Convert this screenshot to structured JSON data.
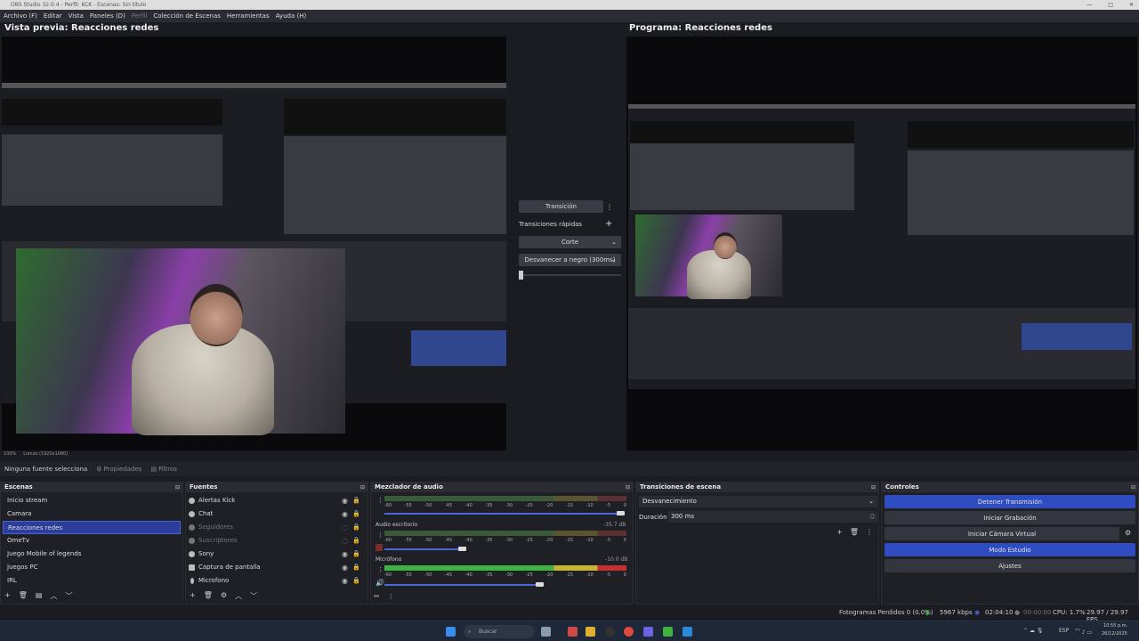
{
  "window": {
    "title": "OBS Studio 32.0.4 - Perfil: KCK - Escenas: Sin título",
    "controls": [
      "—",
      "□",
      "✕"
    ]
  },
  "menu": [
    "Archivo (F)",
    "Editar",
    "Vista",
    "Paneles (D)",
    "Perfil",
    "Colección de Escenas",
    "Herramientas",
    "Ayuda (H)"
  ],
  "preview": {
    "label": "Vista previa: Reacciones redes",
    "zoom": "100%",
    "canvas": "Lienzo (1920x1080)"
  },
  "program": {
    "label": "Programa: Reacciones redes"
  },
  "transition_panel": {
    "transition": "Transición",
    "quick": "Transiciones rápidas",
    "cut": "Corte",
    "fade": "Desvanecer a negro (300ms)"
  },
  "source_bar": {
    "none_selected": "Ninguna fuente selecciona",
    "properties": "Propiedades",
    "filters": "Filtros"
  },
  "scenes": {
    "title": "Escenas",
    "items": [
      "Inicio stream",
      "Camara",
      "Reacciones redes",
      "OmeTv",
      "Juego Mobile of legends",
      "Juegos PC",
      "IRL"
    ],
    "selected": 2
  },
  "sources": {
    "title": "Fuentes",
    "items": [
      "Alertas Kick",
      "Chat",
      "Seguidores",
      "Suscriptores",
      "Sony",
      "Captura de pantalla",
      "Microfono"
    ]
  },
  "mixer": {
    "title": "Mezclador de audio",
    "ticks": [
      "-60",
      "-55",
      "-50",
      "-45",
      "-40",
      "-35",
      "-30",
      "-25",
      "-20",
      "-15",
      "-10",
      "-5",
      "0"
    ],
    "channels": [
      {
        "name": "",
        "db": ""
      },
      {
        "name": "Audio escritorio",
        "db": "-35.7 dB"
      },
      {
        "name": "Micrófono",
        "db": "-10.0 dB"
      }
    ]
  },
  "scene_transitions": {
    "title": "Transiciones de escena",
    "type": "Desvanecimiento",
    "duration_label": "Duración",
    "duration": "300 ms"
  },
  "controls": {
    "title": "Controles",
    "buttons": [
      "Detener Transmisión",
      "Iniciar Grabación",
      "Iniciar Cámara Virtual",
      "Modo Estudio",
      "Ajustes"
    ]
  },
  "status": {
    "dropped": "Fotogramas Perdidos 0 (0.0%)",
    "kbps": "5967 kbps",
    "stream_time": "02:04:10",
    "rec_time": "00:00:00",
    "cpu": "CPU: 1.7%",
    "fps": "29.97 / 29.97 FPS"
  },
  "taskbar": {
    "search": "Buscar",
    "lang": "ESP",
    "time": "10:55 p.m.",
    "date": "26/12/2025"
  }
}
